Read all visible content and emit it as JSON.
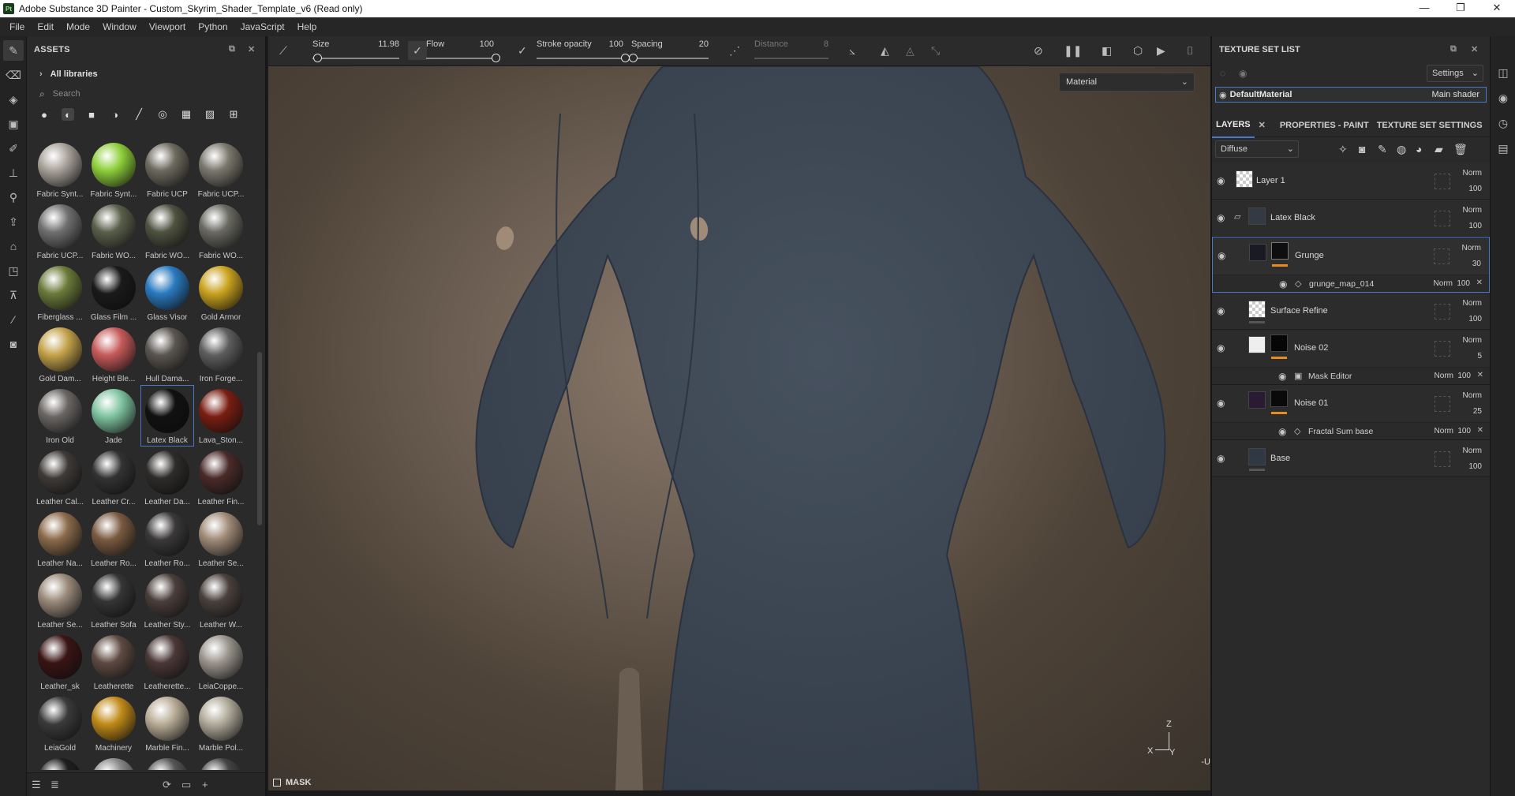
{
  "window": {
    "title": "Adobe Substance 3D Painter - Custom_Skyrim_Shader_Template_v6 (Read only)",
    "logo_text": "Pt",
    "controls": [
      "—",
      "❐",
      "✕"
    ]
  },
  "menu": [
    "File",
    "Edit",
    "Mode",
    "Window",
    "Viewport",
    "Python",
    "JavaScript",
    "Help"
  ],
  "assets": {
    "title": "ASSETS",
    "library": "All libraries",
    "search_placeholder": "Search",
    "items": [
      {
        "label": "Fabric Synt...",
        "color": "#a8a29a"
      },
      {
        "label": "Fabric Synt...",
        "color": "#8ecf3a"
      },
      {
        "label": "Fabric UCP",
        "color": "#6d6a5e"
      },
      {
        "label": "Fabric UCP...",
        "color": "#7b786d"
      },
      {
        "label": "Fabric UCP...",
        "color": "#707070"
      },
      {
        "label": "Fabric WO...",
        "color": "#5a5f4a"
      },
      {
        "label": "Fabric WO...",
        "color": "#4e5240"
      },
      {
        "label": "Fabric WO...",
        "color": "#6a6a62"
      },
      {
        "label": "Fiberglass ...",
        "color": "#6b7a3a"
      },
      {
        "label": "Glass Film ...",
        "color": "#1a1a1a"
      },
      {
        "label": "Glass Visor",
        "color": "#2a7abf"
      },
      {
        "label": "Gold Armor",
        "color": "#c9a21e"
      },
      {
        "label": "Gold Dam...",
        "color": "#c4a24a"
      },
      {
        "label": "Height Ble...",
        "color": "#c75a5a"
      },
      {
        "label": "Hull Dama...",
        "color": "#5a5550"
      },
      {
        "label": "Iron Forge...",
        "color": "#5e5e5e"
      },
      {
        "label": "Iron Old",
        "color": "#6a6664"
      },
      {
        "label": "Jade",
        "color": "#7fc4a0"
      },
      {
        "label": "Latex Black",
        "color": "#111111"
      },
      {
        "label": "Lava_Ston...",
        "color": "#7a1e12"
      },
      {
        "label": "Leather Cal...",
        "color": "#3e3a38"
      },
      {
        "label": "Leather Cr...",
        "color": "#333333"
      },
      {
        "label": "Leather Da...",
        "color": "#2e2c2a"
      },
      {
        "label": "Leather Fin...",
        "color": "#4a2a2a"
      },
      {
        "label": "Leather Na...",
        "color": "#8a6a4a"
      },
      {
        "label": "Leather Ro...",
        "color": "#7a5a40"
      },
      {
        "label": "Leather Ro...",
        "color": "#3a3838"
      },
      {
        "label": "Leather Se...",
        "color": "#a08a78"
      },
      {
        "label": "Leather Se...",
        "color": "#9a8a7a"
      },
      {
        "label": "Leather Sofa",
        "color": "#353535"
      },
      {
        "label": "Leather Sty...",
        "color": "#4a3e3a"
      },
      {
        "label": "Leather W...",
        "color": "#4a403c"
      },
      {
        "label": "Leather_sk",
        "color": "#3a1414"
      },
      {
        "label": "Leatherette",
        "color": "#5e4a42"
      },
      {
        "label": "Leatherette...",
        "color": "#4a3836"
      },
      {
        "label": "LeiaCoppe...",
        "color": "#9a948c"
      },
      {
        "label": "LeiaGold",
        "color": "#3a3a3a"
      },
      {
        "label": "Machinery",
        "color": "#c08a18"
      },
      {
        "label": "Marble Fin...",
        "color": "#b8ac96"
      },
      {
        "label": "Marble Pol...",
        "color": "#b0aa9a"
      },
      {
        "label": "",
        "color": "#1e1e1e"
      },
      {
        "label": "",
        "color": "#888888"
      },
      {
        "label": "",
        "color": "#555555"
      },
      {
        "label": "",
        "color": "#444444"
      }
    ],
    "selected_index": 18
  },
  "toolbar": {
    "size_label": "Size",
    "size_value": "11.98",
    "flow_label": "Flow",
    "flow_value": "100",
    "stroke_opacity_label": "Stroke opacity",
    "stroke_opacity_value": "100",
    "spacing_label": "Spacing",
    "spacing_value": "20",
    "distance_label": "Distance",
    "distance_value": "8"
  },
  "viewport": {
    "material_dropdown": "Material",
    "mask_label": "MASK",
    "axis_z": "Z",
    "axis_x": "X",
    "axis_y": "Y",
    "edge_label": "-U",
    "body_color": "#3c4656"
  },
  "texture_set_list": {
    "title": "TEXTURE SET LIST",
    "settings_label": "Settings",
    "material_name": "DefaultMaterial",
    "shader": "Main shader"
  },
  "layers_panel": {
    "tabs": [
      "LAYERS",
      "PROPERTIES - PAINT",
      "TEXTURE SET SETTINGS"
    ],
    "channel": "Diffuse",
    "layers": [
      {
        "name": "Layer 1",
        "blend": "Norm",
        "opacity": "100"
      },
      {
        "name": "Latex Black",
        "blend": "Norm",
        "opacity": "100"
      },
      {
        "name": "Grunge",
        "blend": "Norm",
        "opacity": "30",
        "sub": {
          "name": "grunge_map_014",
          "blend": "Norm",
          "opacity": "100"
        }
      },
      {
        "name": "Surface Refine",
        "blend": "Norm",
        "opacity": "100"
      },
      {
        "name": "Noise 02",
        "blend": "Norm",
        "opacity": "5",
        "sub": {
          "name": "Mask Editor",
          "blend": "Norm",
          "opacity": "100"
        }
      },
      {
        "name": "Noise 01",
        "blend": "Norm",
        "opacity": "25",
        "sub": {
          "name": "Fractal Sum base",
          "blend": "Norm",
          "opacity": "100"
        }
      },
      {
        "name": "Base",
        "blend": "Norm",
        "opacity": "100"
      }
    ]
  },
  "colors": {
    "accent": "#4a78c8",
    "mask_orange": "#e98c1c"
  }
}
